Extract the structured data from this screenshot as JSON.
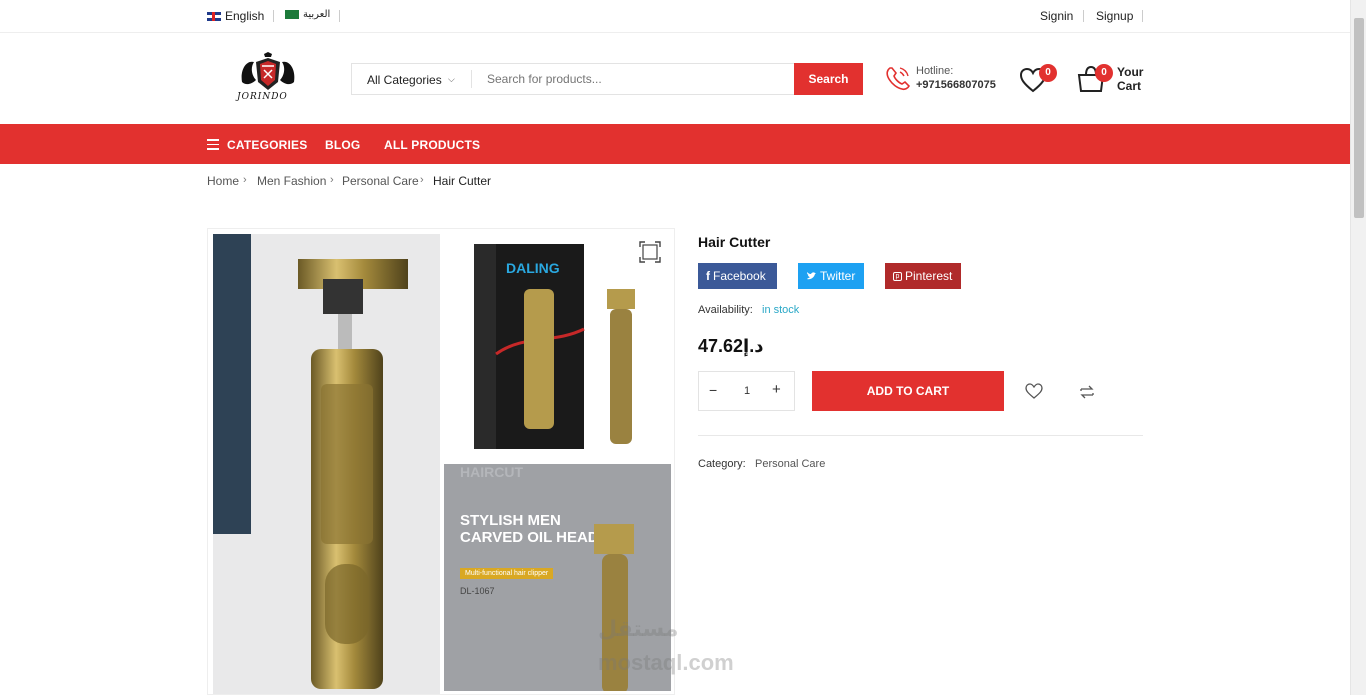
{
  "topbar": {
    "lang_en": "English",
    "lang_ar": "العربية",
    "signin": "Signin",
    "signup": "Signup"
  },
  "brand": {
    "logo_text": "JORINDO"
  },
  "search": {
    "category": "All Categories",
    "placeholder": "Search for products...",
    "button": "Search"
  },
  "hotline": {
    "label": "Hotline:",
    "number": "+971566807075"
  },
  "wishlist": {
    "count": "0"
  },
  "cart": {
    "count": "0",
    "label": "Your Cart"
  },
  "nav": {
    "categories": "CATEGORIES",
    "blog": "BLOG",
    "all_products": "ALL PRODUCTS"
  },
  "breadcrumb": [
    "Home",
    "Men Fashion",
    "Personal Care",
    "Hair Cutter"
  ],
  "gallery": {
    "box_brand": "DALING",
    "hair_top": "HAIRCUT",
    "hair_title": "STYLISH MEN CARVED OIL HEAD",
    "hair_tag": "Multi-functional hair clipper",
    "hair_code": "DL-1067"
  },
  "watermark": {
    "line1": "مستقل",
    "line2": "mostaql.com"
  },
  "product": {
    "title": "Hair Cutter",
    "share_facebook": "Facebook",
    "share_twitter": "Twitter",
    "share_pinterest": "Pinterest",
    "availability_label": "Availability:",
    "availability_value": "in stock",
    "price": "47.62د.إ",
    "quantity": "1",
    "add_to_cart": "ADD TO CART",
    "category_label": "Category:",
    "category_value": "Personal Care"
  },
  "colors": {
    "accent": "#e2312f",
    "facebook": "#3b5998",
    "twitter": "#1da1f2",
    "pinterest": "#b02a2a",
    "stock": "#2aa8c7"
  }
}
